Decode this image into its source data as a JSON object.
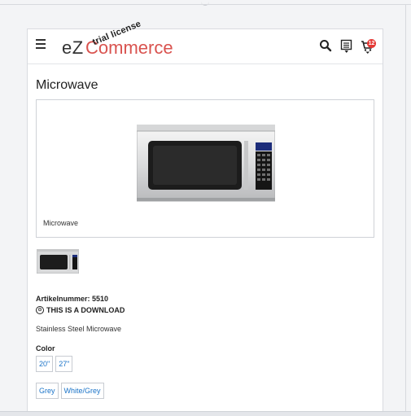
{
  "header": {
    "logo_ez": "eZ",
    "logo_commerce": "Commerce",
    "logo_overlay": "trial license",
    "cart_count": "12"
  },
  "product": {
    "title": "Microwave",
    "image_caption": "Microwave",
    "artikel": "Artikelnummer: 5510",
    "download_label": "THIS IS A DOWNLOAD",
    "description": "Stainless Steel Microwave",
    "color_label": "Color",
    "size_options": [
      "20\"",
      "27\""
    ],
    "color_options": [
      "Grey",
      "White/Grey"
    ]
  },
  "colors": {
    "accent": "#d9534f",
    "link": "#1a73c8",
    "badge": "#e53935"
  },
  "icons": {
    "menu": "hamburger-icon",
    "search": "search-icon",
    "list": "list-icon",
    "cart": "cart-icon"
  }
}
